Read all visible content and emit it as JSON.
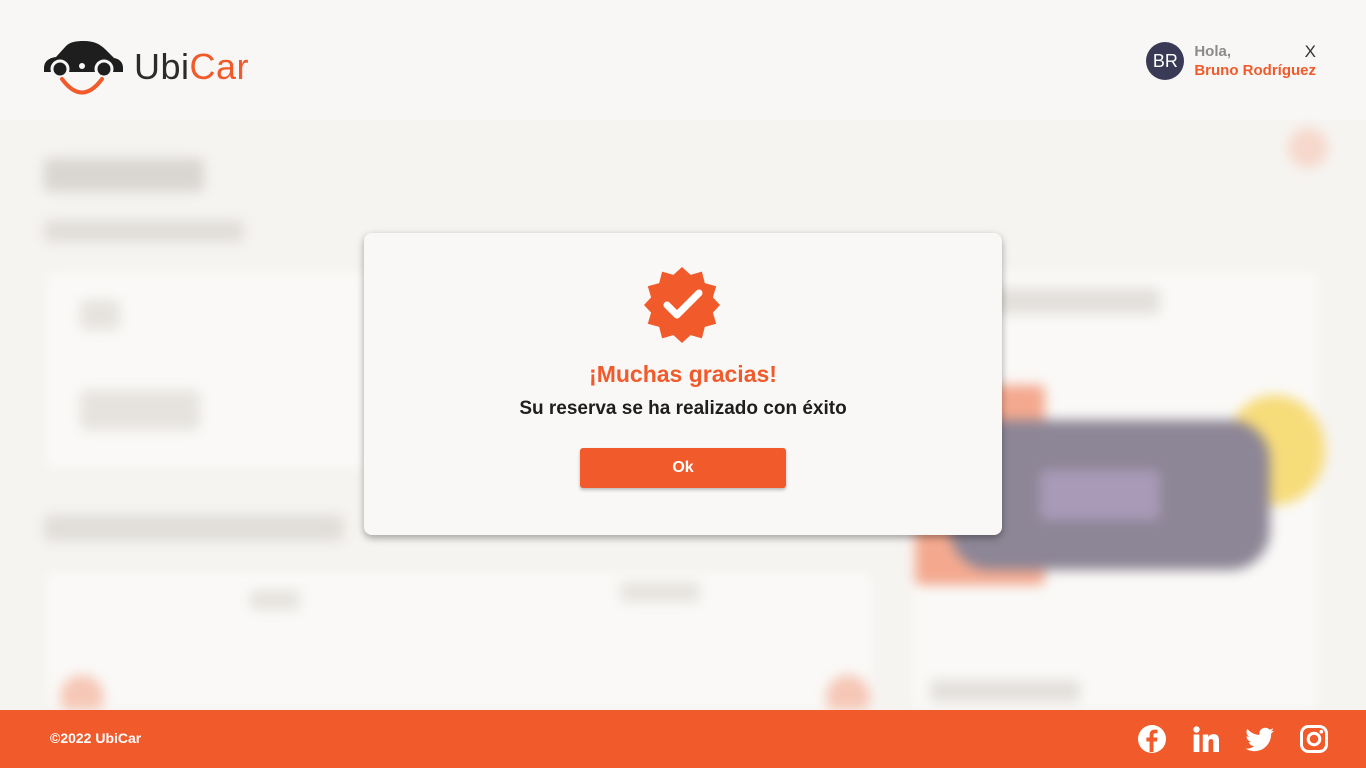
{
  "header": {
    "logo": {
      "ubi": "Ubi",
      "car": "Car"
    },
    "user": {
      "initials": "BR",
      "greeting": "Hola,",
      "name": "Bruno Rodríguez"
    },
    "close_label": "X"
  },
  "modal": {
    "icon": "verified-badge-icon",
    "title": "¡Muchas gracias!",
    "message": "Su reserva se ha realizado con éxito",
    "ok_label": "Ok"
  },
  "footer": {
    "copyright": "©2022 UbiCar",
    "socials": [
      "facebook-icon",
      "linkedin-icon",
      "twitter-icon",
      "instagram-icon"
    ]
  },
  "colors": {
    "brand": "#f15a2b",
    "avatar": "#3a3a56",
    "background": "#f6f4f1"
  }
}
